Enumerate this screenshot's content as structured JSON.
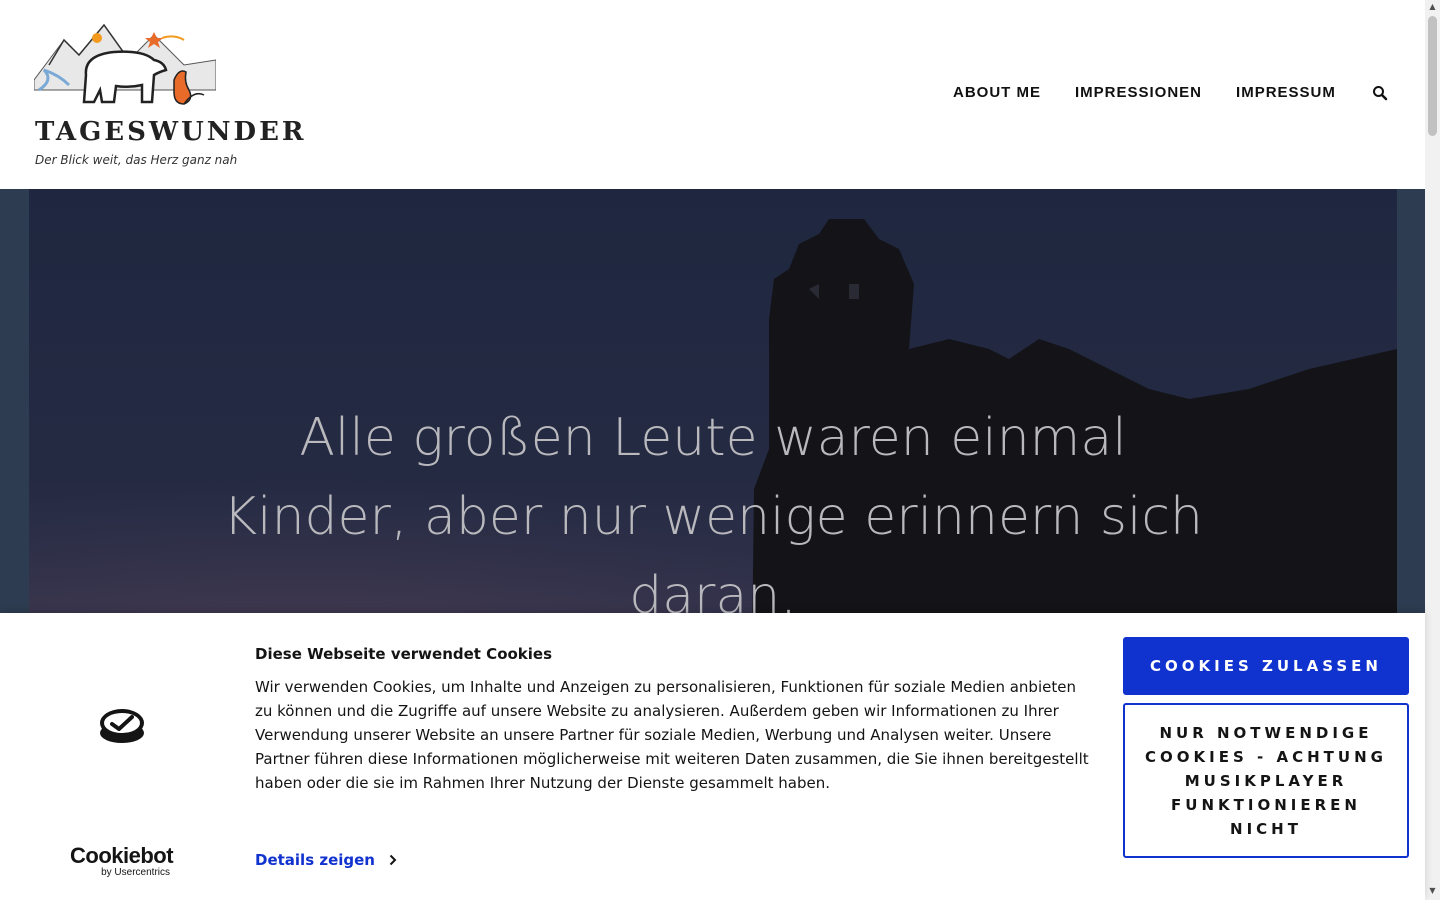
{
  "header": {
    "site_title": "TAGESWUNDER",
    "tagline": "Der Blick weit, das Herz ganz nah"
  },
  "nav": {
    "items": [
      {
        "label": "ABOUT ME"
      },
      {
        "label": "IMPRESSIONEN"
      },
      {
        "label": "IMPRESSUM"
      }
    ]
  },
  "hero": {
    "quote": "Alle großen Leute waren einmal Kinder, aber nur wenige erinnern sich daran."
  },
  "cookie_banner": {
    "title": "Diese Webseite verwendet Cookies",
    "text": "Wir verwenden Cookies, um Inhalte und Anzeigen zu personalisieren, Funktionen für soziale Medien anbieten zu können und die Zugriffe auf unsere Website zu analysieren. Außerdem geben wir Informationen zu Ihrer Verwendung unserer Website an unsere Partner für soziale Medien, Werbung und Analysen weiter. Unsere Partner führen diese Informationen möglicherweise mit weiteren Daten zusammen, die Sie ihnen bereitgestellt haben oder die sie im Rahmen Ihrer Nutzung der Dienste gesammelt haben.",
    "details_label": "Details zeigen",
    "allow_label": "COOKIES ZULASSEN",
    "necessary_label": "NUR NOTWENDIGE COOKIES - ACHTUNG MUSIKPLAYER FUNKTIONIEREN NICHT",
    "brand_main": "Cookiebot",
    "brand_sub": "by Usercentrics"
  },
  "colors": {
    "accent": "#1032cf",
    "text": "#141414",
    "hero_bg": "#2d3c50"
  }
}
